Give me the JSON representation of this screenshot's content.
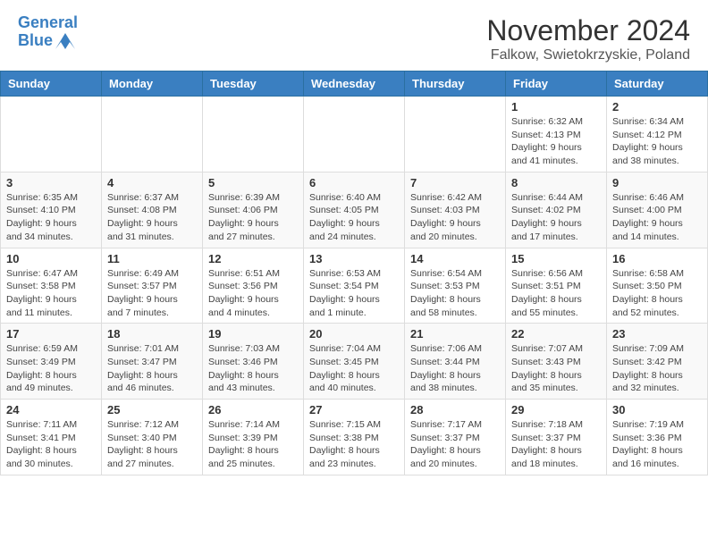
{
  "header": {
    "logo_text_general": "General",
    "logo_text_blue": "Blue",
    "month_title": "November 2024",
    "location": "Falkow, Swietokrzyskie, Poland"
  },
  "calendar": {
    "days_of_week": [
      "Sunday",
      "Monday",
      "Tuesday",
      "Wednesday",
      "Thursday",
      "Friday",
      "Saturday"
    ],
    "weeks": [
      [
        {
          "day": "",
          "info": ""
        },
        {
          "day": "",
          "info": ""
        },
        {
          "day": "",
          "info": ""
        },
        {
          "day": "",
          "info": ""
        },
        {
          "day": "",
          "info": ""
        },
        {
          "day": "1",
          "info": "Sunrise: 6:32 AM\nSunset: 4:13 PM\nDaylight: 9 hours\nand 41 minutes."
        },
        {
          "day": "2",
          "info": "Sunrise: 6:34 AM\nSunset: 4:12 PM\nDaylight: 9 hours\nand 38 minutes."
        }
      ],
      [
        {
          "day": "3",
          "info": "Sunrise: 6:35 AM\nSunset: 4:10 PM\nDaylight: 9 hours\nand 34 minutes."
        },
        {
          "day": "4",
          "info": "Sunrise: 6:37 AM\nSunset: 4:08 PM\nDaylight: 9 hours\nand 31 minutes."
        },
        {
          "day": "5",
          "info": "Sunrise: 6:39 AM\nSunset: 4:06 PM\nDaylight: 9 hours\nand 27 minutes."
        },
        {
          "day": "6",
          "info": "Sunrise: 6:40 AM\nSunset: 4:05 PM\nDaylight: 9 hours\nand 24 minutes."
        },
        {
          "day": "7",
          "info": "Sunrise: 6:42 AM\nSunset: 4:03 PM\nDaylight: 9 hours\nand 20 minutes."
        },
        {
          "day": "8",
          "info": "Sunrise: 6:44 AM\nSunset: 4:02 PM\nDaylight: 9 hours\nand 17 minutes."
        },
        {
          "day": "9",
          "info": "Sunrise: 6:46 AM\nSunset: 4:00 PM\nDaylight: 9 hours\nand 14 minutes."
        }
      ],
      [
        {
          "day": "10",
          "info": "Sunrise: 6:47 AM\nSunset: 3:58 PM\nDaylight: 9 hours\nand 11 minutes."
        },
        {
          "day": "11",
          "info": "Sunrise: 6:49 AM\nSunset: 3:57 PM\nDaylight: 9 hours\nand 7 minutes."
        },
        {
          "day": "12",
          "info": "Sunrise: 6:51 AM\nSunset: 3:56 PM\nDaylight: 9 hours\nand 4 minutes."
        },
        {
          "day": "13",
          "info": "Sunrise: 6:53 AM\nSunset: 3:54 PM\nDaylight: 9 hours\nand 1 minute."
        },
        {
          "day": "14",
          "info": "Sunrise: 6:54 AM\nSunset: 3:53 PM\nDaylight: 8 hours\nand 58 minutes."
        },
        {
          "day": "15",
          "info": "Sunrise: 6:56 AM\nSunset: 3:51 PM\nDaylight: 8 hours\nand 55 minutes."
        },
        {
          "day": "16",
          "info": "Sunrise: 6:58 AM\nSunset: 3:50 PM\nDaylight: 8 hours\nand 52 minutes."
        }
      ],
      [
        {
          "day": "17",
          "info": "Sunrise: 6:59 AM\nSunset: 3:49 PM\nDaylight: 8 hours\nand 49 minutes."
        },
        {
          "day": "18",
          "info": "Sunrise: 7:01 AM\nSunset: 3:47 PM\nDaylight: 8 hours\nand 46 minutes."
        },
        {
          "day": "19",
          "info": "Sunrise: 7:03 AM\nSunset: 3:46 PM\nDaylight: 8 hours\nand 43 minutes."
        },
        {
          "day": "20",
          "info": "Sunrise: 7:04 AM\nSunset: 3:45 PM\nDaylight: 8 hours\nand 40 minutes."
        },
        {
          "day": "21",
          "info": "Sunrise: 7:06 AM\nSunset: 3:44 PM\nDaylight: 8 hours\nand 38 minutes."
        },
        {
          "day": "22",
          "info": "Sunrise: 7:07 AM\nSunset: 3:43 PM\nDaylight: 8 hours\nand 35 minutes."
        },
        {
          "day": "23",
          "info": "Sunrise: 7:09 AM\nSunset: 3:42 PM\nDaylight: 8 hours\nand 32 minutes."
        }
      ],
      [
        {
          "day": "24",
          "info": "Sunrise: 7:11 AM\nSunset: 3:41 PM\nDaylight: 8 hours\nand 30 minutes."
        },
        {
          "day": "25",
          "info": "Sunrise: 7:12 AM\nSunset: 3:40 PM\nDaylight: 8 hours\nand 27 minutes."
        },
        {
          "day": "26",
          "info": "Sunrise: 7:14 AM\nSunset: 3:39 PM\nDaylight: 8 hours\nand 25 minutes."
        },
        {
          "day": "27",
          "info": "Sunrise: 7:15 AM\nSunset: 3:38 PM\nDaylight: 8 hours\nand 23 minutes."
        },
        {
          "day": "28",
          "info": "Sunrise: 7:17 AM\nSunset: 3:37 PM\nDaylight: 8 hours\nand 20 minutes."
        },
        {
          "day": "29",
          "info": "Sunrise: 7:18 AM\nSunset: 3:37 PM\nDaylight: 8 hours\nand 18 minutes."
        },
        {
          "day": "30",
          "info": "Sunrise: 7:19 AM\nSunset: 3:36 PM\nDaylight: 8 hours\nand 16 minutes."
        }
      ]
    ]
  }
}
